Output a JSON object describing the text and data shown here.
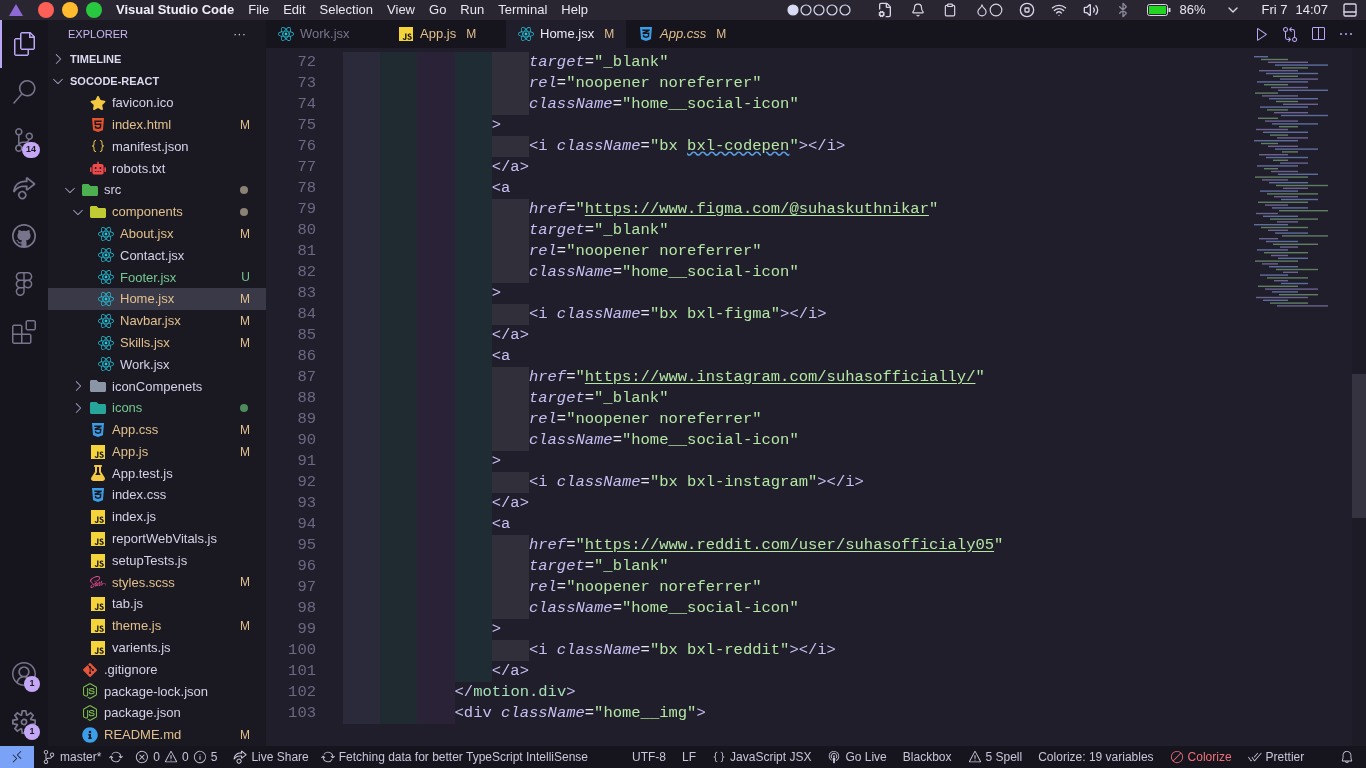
{
  "menubar": {
    "app_name": "Visual Studio Code",
    "traffic_lights": [
      {
        "color": "#fe5f57"
      },
      {
        "color": "#febc2e"
      },
      {
        "color": "#28c840"
      }
    ],
    "menus": [
      "File",
      "Edit",
      "Selection",
      "View",
      "Go",
      "Run",
      "Terminal",
      "Help"
    ],
    "battery": "86%",
    "date": "Fri 7",
    "time": "14:07"
  },
  "activity_bar": {
    "top": [
      {
        "kind": "explorer",
        "selected": true
      },
      {
        "kind": "search",
        "selected": false
      },
      {
        "kind": "source-control",
        "selected": false,
        "badge": "14"
      },
      {
        "kind": "live-share",
        "selected": false
      },
      {
        "kind": "github",
        "selected": false
      },
      {
        "kind": "figma",
        "selected": false
      },
      {
        "kind": "extensions",
        "selected": false
      }
    ],
    "bottom": [
      {
        "kind": "account",
        "badge": "1"
      },
      {
        "kind": "settings",
        "badge": "1"
      }
    ]
  },
  "sidebar": {
    "title": "EXPLORER",
    "more": "···",
    "sections": [
      {
        "label": "TIMELINE",
        "expanded": false
      },
      {
        "label": "SOCODE-REACT",
        "expanded": true
      }
    ],
    "tree": [
      {
        "children": [
          {
            "label": "favicon.ico",
            "kind": "star",
            "modified": false,
            "untracked": false,
            "selected": false
          },
          {
            "label": "index.html",
            "kind": "html",
            "modified": true,
            "untracked": false,
            "badge": "M",
            "selected": false
          },
          {
            "label": "manifest.json",
            "kind": "json",
            "modified": false,
            "untracked": false,
            "selected": false
          },
          {
            "label": "robots.txt",
            "kind": "robot",
            "modified": false,
            "untracked": false,
            "selected": false
          }
        ]
      },
      {
        "label": "src",
        "kind": "folder-src",
        "modified": false,
        "untracked": false,
        "color": "#8a8275",
        "expanded": true,
        "selected": false,
        "children": [
          {
            "label": "components",
            "kind": "folder-components",
            "modified": true,
            "untracked": false,
            "color": "#8a8275",
            "expanded": true,
            "selected": false,
            "children": [
              {
                "label": "About.jsx",
                "kind": "react",
                "modified": true,
                "untracked": false,
                "badge": "M",
                "selected": false
              },
              {
                "label": "Contact.jsx",
                "kind": "react",
                "modified": false,
                "untracked": false,
                "selected": false
              },
              {
                "label": "Footer.jsx",
                "kind": "react",
                "modified": false,
                "untracked": true,
                "badge": "U",
                "selected": false
              },
              {
                "label": "Home.jsx",
                "kind": "react",
                "modified": true,
                "untracked": false,
                "badge": "M",
                "selected": true
              },
              {
                "label": "Navbar.jsx",
                "kind": "react",
                "modified": true,
                "untracked": false,
                "badge": "M",
                "selected": false
              },
              {
                "label": "Skills.jsx",
                "kind": "react",
                "modified": true,
                "untracked": false,
                "badge": "M",
                "selected": false
              },
              {
                "label": "Work.jsx",
                "kind": "react",
                "modified": false,
                "untracked": false,
                "selected": false
              }
            ]
          },
          {
            "label": "iconCompenets",
            "kind": "folder",
            "modified": false,
            "untracked": false,
            "expanded": false,
            "selected": false
          },
          {
            "label": "icons",
            "kind": "folder-icons",
            "modified": false,
            "untracked": true,
            "color": "#4f8a5c",
            "expanded": false,
            "selected": false
          },
          {
            "label": "App.css",
            "kind": "css",
            "modified": true,
            "untracked": false,
            "badge": "M",
            "selected": false
          },
          {
            "label": "App.js",
            "kind": "js",
            "modified": true,
            "untracked": false,
            "badge": "M",
            "selected": false
          },
          {
            "label": "App.test.js",
            "kind": "test",
            "modified": false,
            "untracked": false,
            "selected": false
          },
          {
            "label": "index.css",
            "kind": "css",
            "modified": false,
            "untracked": false,
            "selected": false
          },
          {
            "label": "index.js",
            "kind": "js",
            "modified": false,
            "untracked": false,
            "selected": false
          },
          {
            "label": "reportWebVitals.js",
            "kind": "js",
            "modified": false,
            "untracked": false,
            "selected": false
          },
          {
            "label": "setupTests.js",
            "kind": "js",
            "modified": false,
            "untracked": false,
            "selected": false
          },
          {
            "label": "styles.scss",
            "kind": "sass",
            "modified": true,
            "untracked": false,
            "badge": "M",
            "selected": false
          },
          {
            "label": "tab.js",
            "kind": "js",
            "modified": false,
            "untracked": false,
            "selected": false
          },
          {
            "label": "theme.js",
            "kind": "js",
            "modified": true,
            "untracked": false,
            "badge": "M",
            "selected": false
          },
          {
            "label": "varients.js",
            "kind": "js",
            "modified": false,
            "untracked": false,
            "selected": false
          }
        ]
      },
      {
        "label": ".gitignore",
        "kind": "git",
        "modified": false,
        "untracked": false,
        "selected": false
      },
      {
        "label": "package-lock.json",
        "kind": "node",
        "modified": false,
        "untracked": false,
        "selected": false
      },
      {
        "label": "package.json",
        "kind": "node",
        "modified": false,
        "untracked": false,
        "selected": false
      },
      {
        "label": "README.md",
        "kind": "info",
        "modified": true,
        "untracked": false,
        "badge": "M",
        "selected": false
      }
    ]
  },
  "tabs": [
    {
      "label": "Work.jsx",
      "kind": "react",
      "modified": false,
      "preview": false,
      "selected": false
    },
    {
      "label": "App.js",
      "kind": "js",
      "modified": true,
      "badge": "M",
      "preview": false,
      "selected": false
    },
    {
      "label": "Home.jsx",
      "kind": "react",
      "modified": true,
      "badge": "M",
      "preview": false,
      "selected": true
    },
    {
      "label": "App.css",
      "kind": "css",
      "modified": true,
      "badge": "M",
      "preview": true,
      "selected": false
    }
  ],
  "editor": {
    "lines": [
      {
        "children": [
          {
            "children": [
              {
                "number": "72",
                "tokens": [
                  {
                    "kind": "attr",
                    "t": "target"
                  },
                  {
                    "kind": "op",
                    "t": "="
                  },
                  {
                    "kind": "str",
                    "t": "\"_blank\""
                  }
                ]
              },
              {
                "number": "73",
                "tokens": [
                  {
                    "kind": "attr",
                    "t": "rel"
                  },
                  {
                    "kind": "op",
                    "t": "="
                  },
                  {
                    "kind": "str",
                    "t": "\"noopener noreferrer\""
                  }
                ]
              },
              {
                "number": "74",
                "tokens": [
                  {
                    "kind": "attr",
                    "t": "className"
                  },
                  {
                    "kind": "op",
                    "t": "="
                  },
                  {
                    "kind": "str",
                    "t": "\"home__social-icon\""
                  }
                ]
              }
            ]
          },
          {
            "number": "75",
            "tokens": [
              {
                "kind": "tag",
                "t": ">"
              }
            ],
            "children": [
              {
                "number": "76",
                "tokens": [
                  {
                    "kind": "tag",
                    "t": "<i "
                  },
                  {
                    "kind": "attr",
                    "t": "className"
                  },
                  {
                    "kind": "op",
                    "t": "="
                  },
                  {
                    "kind": "str",
                    "t": "\"bx "
                  },
                  {
                    "kind": "warn",
                    "t": "bxl-codepen"
                  },
                  {
                    "kind": "str",
                    "t": "\""
                  },
                  {
                    "kind": "tag",
                    "t": "></i>"
                  }
                ]
              }
            ]
          },
          {
            "number": "77",
            "tokens": [
              {
                "kind": "tag",
                "t": "</a>"
              }
            ]
          },
          {
            "number": "78",
            "tokens": [
              {
                "kind": "tag",
                "t": "<a"
              }
            ],
            "children": [
              {
                "number": "79",
                "tokens": [
                  {
                    "kind": "attr",
                    "t": "href"
                  },
                  {
                    "kind": "op",
                    "t": "="
                  },
                  {
                    "kind": "str",
                    "t": "\""
                  },
                  {
                    "kind": "url",
                    "t": "https://www.figma.com/@suhaskuthnikar"
                  },
                  {
                    "kind": "str",
                    "t": "\""
                  }
                ]
              },
              {
                "number": "80",
                "tokens": [
                  {
                    "kind": "attr",
                    "t": "target"
                  },
                  {
                    "kind": "op",
                    "t": "="
                  },
                  {
                    "kind": "str",
                    "t": "\"_blank\""
                  }
                ]
              },
              {
                "number": "81",
                "tokens": [
                  {
                    "kind": "attr",
                    "t": "rel"
                  },
                  {
                    "kind": "op",
                    "t": "="
                  },
                  {
                    "kind": "str",
                    "t": "\"noopener noreferrer\""
                  }
                ]
              },
              {
                "number": "82",
                "tokens": [
                  {
                    "kind": "attr",
                    "t": "className"
                  },
                  {
                    "kind": "op",
                    "t": "="
                  },
                  {
                    "kind": "str",
                    "t": "\"home__social-icon\""
                  }
                ]
              }
            ]
          },
          {
            "number": "83",
            "tokens": [
              {
                "kind": "tag",
                "t": ">"
              }
            ],
            "children": [
              {
                "number": "84",
                "tokens": [
                  {
                    "kind": "tag",
                    "t": "<i "
                  },
                  {
                    "kind": "attr",
                    "t": "className"
                  },
                  {
                    "kind": "op",
                    "t": "="
                  },
                  {
                    "kind": "str",
                    "t": "\"bx bxl-figma\""
                  },
                  {
                    "kind": "tag",
                    "t": "></i>"
                  }
                ]
              }
            ]
          },
          {
            "number": "85",
            "tokens": [
              {
                "kind": "tag",
                "t": "</a>"
              }
            ]
          },
          {
            "number": "86",
            "tokens": [
              {
                "kind": "tag",
                "t": "<a"
              }
            ],
            "children": [
              {
                "number": "87",
                "tokens": [
                  {
                    "kind": "attr",
                    "t": "href"
                  },
                  {
                    "kind": "op",
                    "t": "="
                  },
                  {
                    "kind": "str",
                    "t": "\""
                  },
                  {
                    "kind": "url",
                    "t": "https://www.instagram.com/suhasofficially/"
                  },
                  {
                    "kind": "str",
                    "t": "\""
                  }
                ]
              },
              {
                "number": "88",
                "tokens": [
                  {
                    "kind": "attr",
                    "t": "target"
                  },
                  {
                    "kind": "op",
                    "t": "="
                  },
                  {
                    "kind": "str",
                    "t": "\"_blank\""
                  }
                ]
              },
              {
                "number": "89",
                "tokens": [
                  {
                    "kind": "attr",
                    "t": "rel"
                  },
                  {
                    "kind": "op",
                    "t": "="
                  },
                  {
                    "kind": "str",
                    "t": "\"noopener noreferrer\""
                  }
                ]
              },
              {
                "number": "90",
                "tokens": [
                  {
                    "kind": "attr",
                    "t": "className"
                  },
                  {
                    "kind": "op",
                    "t": "="
                  },
                  {
                    "kind": "str",
                    "t": "\"home__social-icon\""
                  }
                ]
              }
            ]
          },
          {
            "number": "91",
            "tokens": [
              {
                "kind": "tag",
                "t": ">"
              }
            ],
            "children": [
              {
                "number": "92",
                "tokens": [
                  {
                    "kind": "tag",
                    "t": "<i "
                  },
                  {
                    "kind": "attr",
                    "t": "className"
                  },
                  {
                    "kind": "op",
                    "t": "="
                  },
                  {
                    "kind": "str",
                    "t": "\"bx bxl-instagram\""
                  },
                  {
                    "kind": "tag",
                    "t": "></i>"
                  }
                ]
              }
            ]
          },
          {
            "number": "93",
            "tokens": [
              {
                "kind": "tag",
                "t": "</a>"
              }
            ]
          },
          {
            "number": "94",
            "tokens": [
              {
                "kind": "tag",
                "t": "<a"
              }
            ],
            "children": [
              {
                "number": "95",
                "tokens": [
                  {
                    "kind": "attr",
                    "t": "href"
                  },
                  {
                    "kind": "op",
                    "t": "="
                  },
                  {
                    "kind": "str",
                    "t": "\""
                  },
                  {
                    "kind": "url",
                    "t": "https://www.reddit.com/user/suhasofficialy05"
                  },
                  {
                    "kind": "str",
                    "t": "\""
                  }
                ]
              },
              {
                "number": "96",
                "tokens": [
                  {
                    "kind": "attr",
                    "t": "target"
                  },
                  {
                    "kind": "op",
                    "t": "="
                  },
                  {
                    "kind": "str",
                    "t": "\"_blank\""
                  }
                ]
              },
              {
                "number": "97",
                "tokens": [
                  {
                    "kind": "attr",
                    "t": "rel"
                  },
                  {
                    "kind": "op",
                    "t": "="
                  },
                  {
                    "kind": "str",
                    "t": "\"noopener noreferrer\""
                  }
                ]
              },
              {
                "number": "98",
                "tokens": [
                  {
                    "kind": "attr",
                    "t": "className"
                  },
                  {
                    "kind": "op",
                    "t": "="
                  },
                  {
                    "kind": "str",
                    "t": "\"home__social-icon\""
                  }
                ]
              }
            ]
          },
          {
            "number": "99",
            "tokens": [
              {
                "kind": "tag",
                "t": ">"
              }
            ],
            "children": [
              {
                "number": "100",
                "tokens": [
                  {
                    "kind": "tag",
                    "t": "<i "
                  },
                  {
                    "kind": "attr",
                    "t": "className"
                  },
                  {
                    "kind": "op",
                    "t": "="
                  },
                  {
                    "kind": "str",
                    "t": "\"bx bxl-reddit\""
                  },
                  {
                    "kind": "tag",
                    "t": "></i>"
                  }
                ]
              }
            ]
          },
          {
            "number": "101",
            "tokens": [
              {
                "kind": "tag",
                "t": "</a>"
              }
            ]
          }
        ]
      },
      {
        "number": "102",
        "tokens": [
          {
            "kind": "tag",
            "t": "</"
          },
          {
            "kind": "comp",
            "t": "motion.div"
          },
          {
            "kind": "tag",
            "t": ">"
          }
        ]
      },
      {
        "number": "103",
        "tokens": [
          {
            "kind": "tag",
            "t": "<div "
          },
          {
            "kind": "attr",
            "t": "className"
          },
          {
            "kind": "op",
            "t": "="
          },
          {
            "kind": "str",
            "t": "\"home__img\""
          },
          {
            "kind": "tag",
            "t": ">"
          }
        ]
      }
    ]
  },
  "status_bar": {
    "branch": "master*",
    "errors": "0",
    "warnings": "0",
    "infos": "5",
    "live_share": "Live Share",
    "fetching": "Fetching data for better TypeScript IntelliSense",
    "encoding": "UTF-8",
    "eol": "LF",
    "language": "JavaScript JSX",
    "go_live": "Go Live",
    "blackbox": "Blackbox",
    "spell": "5 Spell",
    "colorize_info": "Colorize: 19 variables",
    "colorize": "Colorize",
    "prettier": "Prettier"
  }
}
